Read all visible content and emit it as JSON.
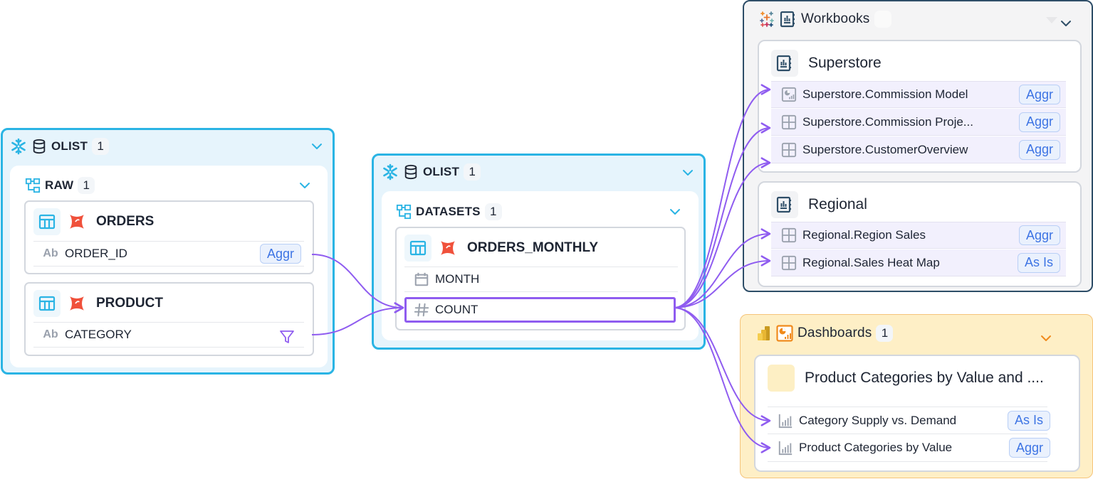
{
  "colors": {
    "snowflake_border": "#2ab4e4",
    "snowflake_bg": "#e6f4fc",
    "workbook_border": "#2e4e68",
    "dashboard_bg": "#feefc6",
    "edge": "#8f5cf0",
    "tag_text": "#3d74e4",
    "dbt_red": "#f0513b"
  },
  "source_group": {
    "title": "OLIST",
    "count": "1",
    "schema": {
      "title": "RAW",
      "count": "1"
    },
    "tables": [
      {
        "name": "ORDERS",
        "columns": [
          {
            "type_icon": "Ab",
            "name": "ORDER_ID",
            "tag": "Aggr"
          }
        ]
      },
      {
        "name": "PRODUCT",
        "columns": [
          {
            "type_icon": "Ab",
            "name": "CATEGORY",
            "tag_icon": "filter-icon"
          }
        ]
      }
    ]
  },
  "middle_group": {
    "title": "OLIST",
    "count": "1",
    "schema": {
      "title": "DATASETS",
      "count": "1"
    },
    "table": {
      "name": "ORDERS_MONTHLY",
      "columns": [
        {
          "type_icon": "calendar-icon",
          "name": "MONTH"
        },
        {
          "type_icon": "#",
          "name": "COUNT",
          "selected": true
        }
      ]
    }
  },
  "workbooks_group": {
    "title": "Workbooks",
    "count": "",
    "workbooks": [
      {
        "name": "Superstore",
        "views": [
          {
            "icon": "dashboard-icon",
            "name": "Superstore.Commission Model",
            "tag": "Aggr"
          },
          {
            "icon": "sheet-icon",
            "name": "Superstore.Commission Proje...",
            "tag": "Aggr"
          },
          {
            "icon": "sheet-icon",
            "name": "Superstore.CustomerOverview",
            "tag": "Aggr"
          }
        ]
      },
      {
        "name": "Regional",
        "views": [
          {
            "icon": "sheet-icon",
            "name": "Regional.Region Sales",
            "tag": "Aggr"
          },
          {
            "icon": "sheet-icon",
            "name": "Regional.Sales Heat Map",
            "tag": "As Is"
          }
        ]
      }
    ]
  },
  "dashboards_group": {
    "title": "Dashboards",
    "count": "1",
    "dashboard": {
      "name": "Product Categories by Value and ....",
      "visuals": [
        {
          "name": "Category Supply vs. Demand",
          "tag": "As Is"
        },
        {
          "name": "Product Categories by Value",
          "tag": "Aggr"
        }
      ]
    }
  },
  "edges": [
    {
      "from": "ORDERS.ORDER_ID",
      "to": "ORDERS_MONTHLY.COUNT"
    },
    {
      "from": "PRODUCT.CATEGORY",
      "to": "ORDERS_MONTHLY.COUNT"
    },
    {
      "from": "ORDERS_MONTHLY.COUNT",
      "to": "Superstore.Commission Model"
    },
    {
      "from": "ORDERS_MONTHLY.COUNT",
      "to": "Superstore.Commission Proje..."
    },
    {
      "from": "ORDERS_MONTHLY.COUNT",
      "to": "Superstore.CustomerOverview"
    },
    {
      "from": "ORDERS_MONTHLY.COUNT",
      "to": "Regional.Region Sales"
    },
    {
      "from": "ORDERS_MONTHLY.COUNT",
      "to": "Regional.Sales Heat Map"
    },
    {
      "from": "ORDERS_MONTHLY.COUNT",
      "to": "Category Supply vs. Demand"
    },
    {
      "from": "ORDERS_MONTHLY.COUNT",
      "to": "Product Categories by Value"
    }
  ]
}
